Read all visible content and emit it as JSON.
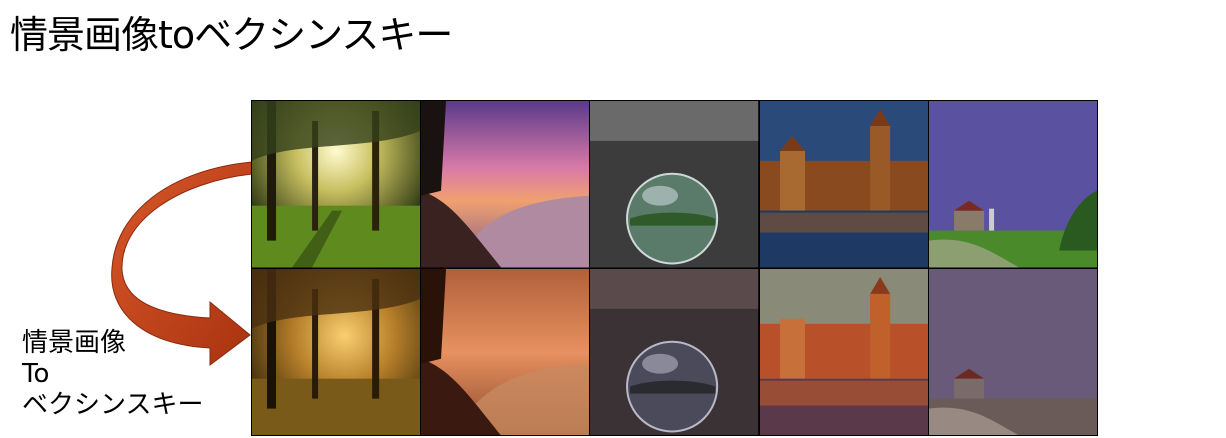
{
  "title": "情景画像toベクシンスキー",
  "side_label": {
    "line1": "情景画像",
    "line2": "To",
    "line3": "ベクシンスキー"
  },
  "arrow": {
    "icon": "curved-arrow-icon",
    "color": "#c0401a"
  },
  "grid": {
    "rows": [
      {
        "name": "original",
        "images": [
          {
            "name": "sunlit-forest",
            "scene": "forest"
          },
          {
            "name": "pink-sunset-beach",
            "scene": "beach"
          },
          {
            "name": "glass-sphere",
            "scene": "sphere"
          },
          {
            "name": "canal-town",
            "scene": "canal"
          },
          {
            "name": "farm-field-purple-sky",
            "scene": "farm"
          }
        ]
      },
      {
        "name": "stylized",
        "images": [
          {
            "name": "sunlit-forest-stylized",
            "scene": "forest"
          },
          {
            "name": "beach-stylized",
            "scene": "beach"
          },
          {
            "name": "glass-sphere-stylized",
            "scene": "sphere"
          },
          {
            "name": "canal-town-stylized",
            "scene": "canal"
          },
          {
            "name": "farm-field-stylized",
            "scene": "farm"
          }
        ]
      }
    ]
  }
}
